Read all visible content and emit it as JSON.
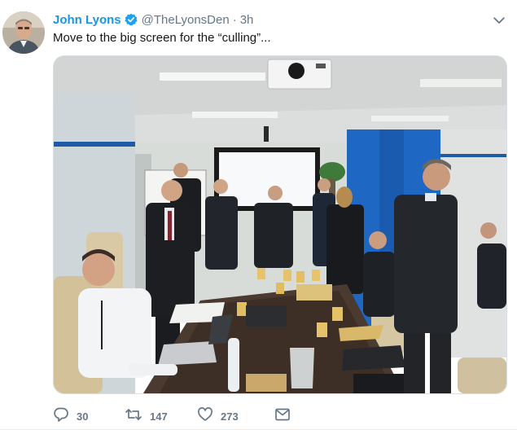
{
  "tweet": {
    "author_name": "John Lyons",
    "handle": "@TheLyonsDen",
    "separator": "·",
    "time": "3h",
    "text": "Move to the big screen for the “culling”...",
    "media": {
      "alt": "Photo of a meeting room; people stand watching a large screen while others sit at a conference table"
    }
  },
  "actions": {
    "reply_count": "30",
    "retweet_count": "147",
    "like_count": "273"
  },
  "icons": {
    "verified": "verified-badge-icon",
    "menu": "chevron-down-icon",
    "reply": "reply-icon",
    "retweet": "retweet-icon",
    "like": "heart-icon",
    "message": "envelope-icon"
  },
  "colors": {
    "name": "#1b95e0",
    "muted": "#657786",
    "text": "#14171a",
    "verified": "#1da1f2"
  }
}
